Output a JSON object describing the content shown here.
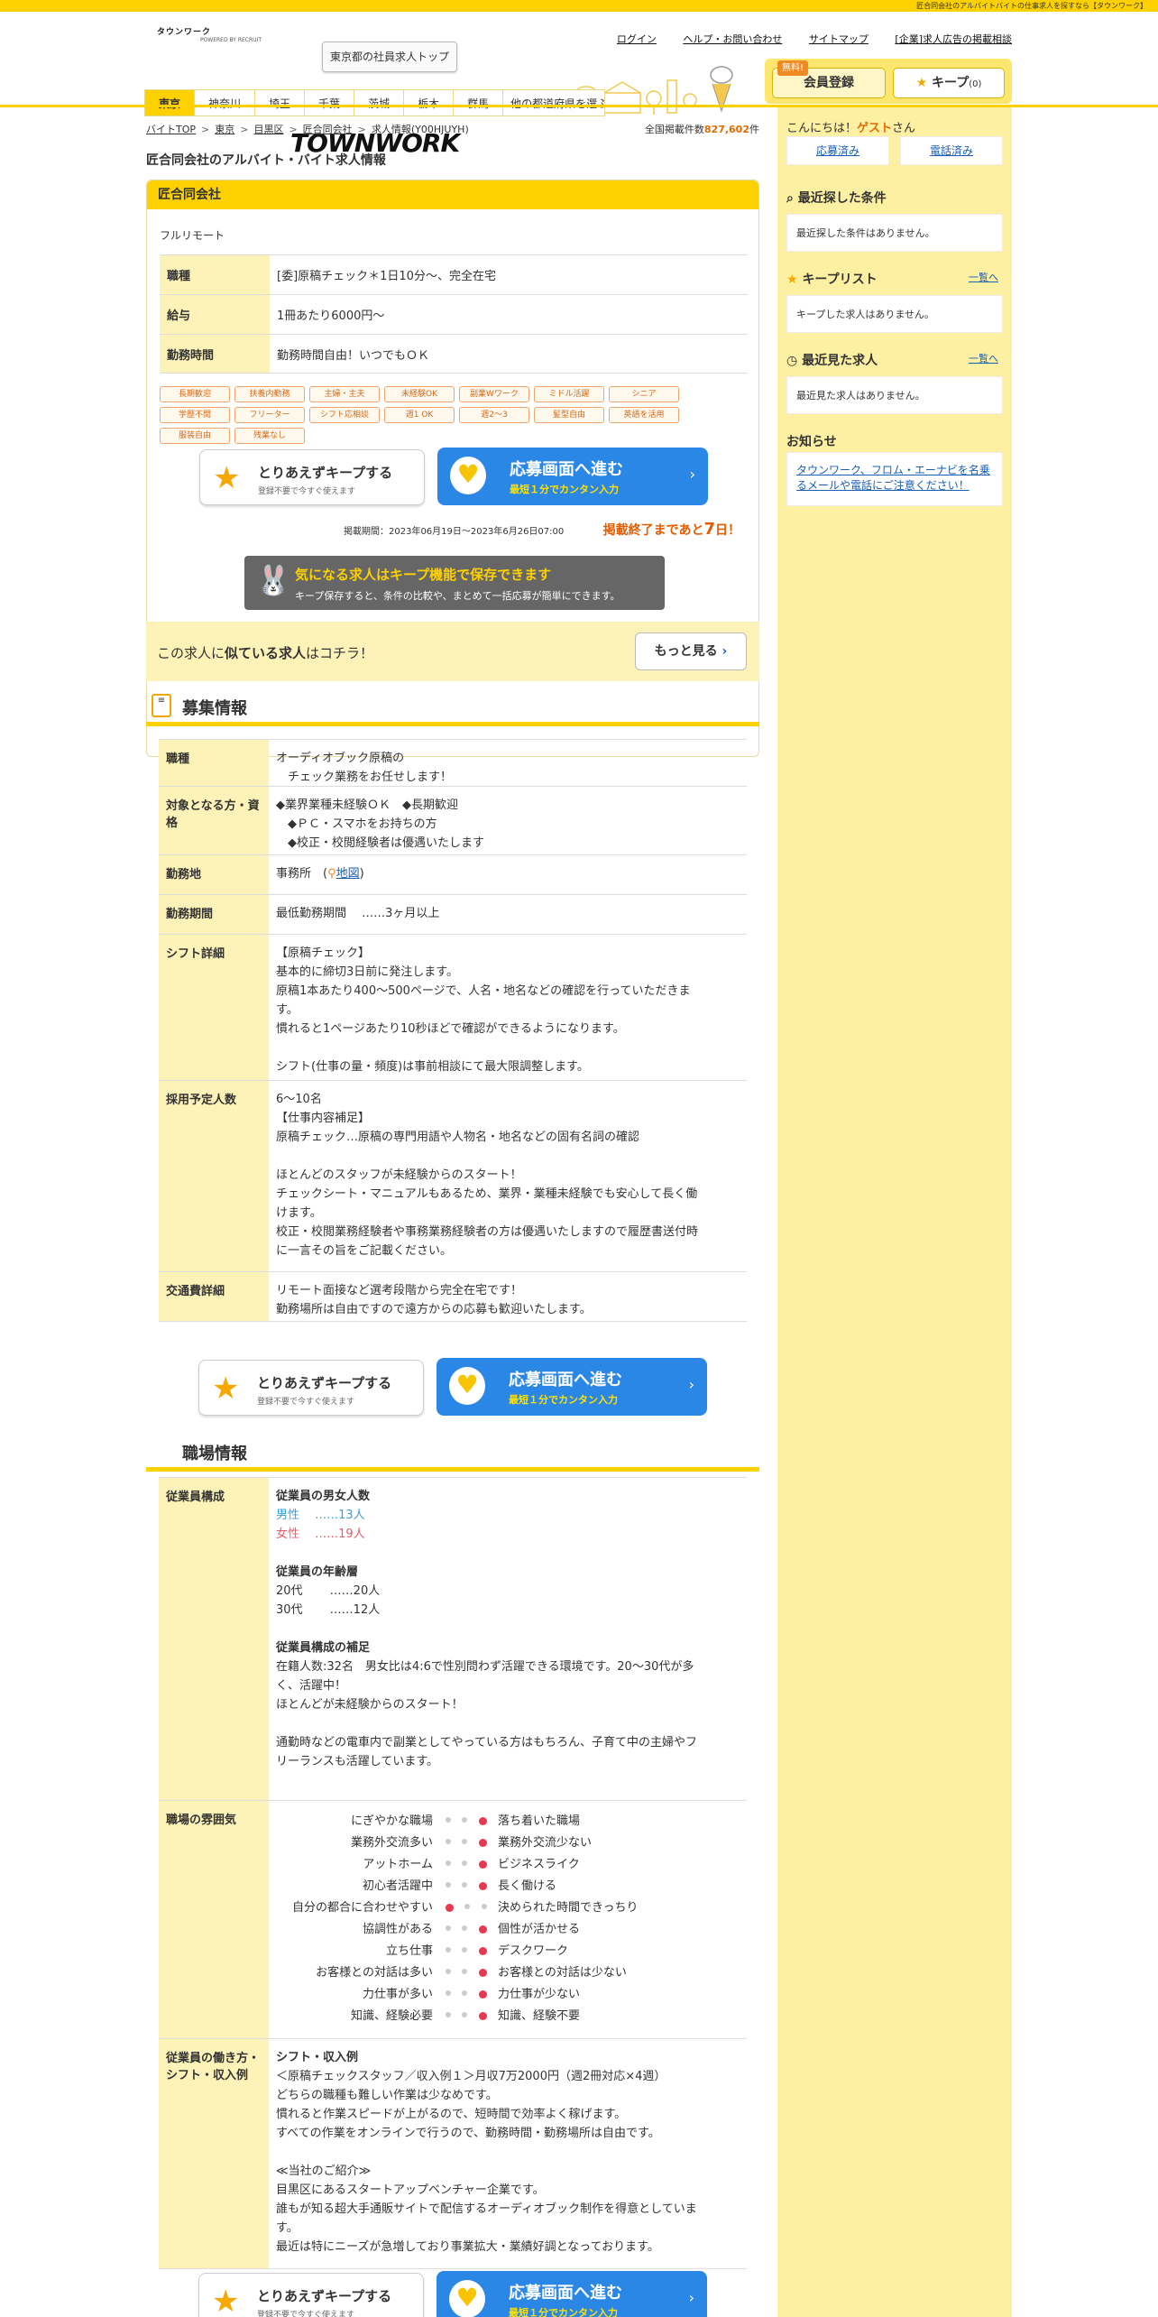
{
  "topbar": "匠合同会社のアルバイトバイトの仕事求人を探すなら【タウンワーク】",
  "logo": {
    "kana": "タウンワーク",
    "main": "TOWNWORK",
    "powered": "POWERED BY RECRUIT"
  },
  "header_button": "東京都の社員求人トップ",
  "toplinks": [
    "ログイン",
    "ヘルプ・お問い合わせ",
    "サイトマップ",
    "[企業]求人広告の掲載相談"
  ],
  "member": {
    "free": "無料!",
    "register": "会員登録",
    "keep": "キープ",
    "keep_count": "(0)"
  },
  "tabs": [
    "東京",
    "神奈川",
    "埼玉",
    "千葉",
    "茨城",
    "栃木",
    "群馬",
    "他の都道府県を選ぶ"
  ],
  "breadcrumb": [
    "バイトTOP",
    "東京",
    "目黒区",
    "匠合同会社",
    "求人情報(Y00HJUYH)"
  ],
  "count": {
    "label": "全国掲載件数",
    "value": "827,602",
    "unit": "件"
  },
  "page_title": "匠合同会社のアルバイト・バイト求人情報",
  "company": "匠合同会社",
  "remote": "フルリモート",
  "summary": [
    {
      "th": "職種",
      "td": "[委]原稿チェック＊1日10分～、完全在宅"
    },
    {
      "th": "給与",
      "td": "1冊あたり6000円～"
    },
    {
      "th": "勤務時間",
      "td": "勤務時間自由！いつでもＯＫ"
    }
  ],
  "tags": [
    "長期歓迎",
    "扶養内勤務",
    "主婦・主夫",
    "未経験OK",
    "副業Wワーク",
    "ミドル活躍",
    "シニア",
    "学歴不問",
    "フリーター",
    "シフト応相談",
    "週1 OK",
    "週2～3",
    "髪型自由",
    "英語を活用",
    "服装自由",
    "残業なし"
  ],
  "keep_cta": {
    "t1": "とりあえずキープする",
    "t2": "登録不要で今すぐ使えます"
  },
  "apply_cta": {
    "t1": "応募画面へ進む",
    "t2": "最短１分でカンタン入力"
  },
  "period": "掲載期間：2023年06月19日～2023年6月26日07:00",
  "deadline": {
    "pre": "掲載終了まであと",
    "num": "7",
    "post": "日！"
  },
  "keep_banner": {
    "t1": "気になる求人はキープ機能で保存できます",
    "t2": "キープ保存すると、条件の比較や、まとめて一括応募が簡単にできます。"
  },
  "similar": {
    "pre": "この求人に",
    "bold": "似ている求人",
    "post": "はコチラ！",
    "more": "もっと見る"
  },
  "recruit_title": "募集情報",
  "recruit": {
    "job_th": "職種",
    "job": [
      "オーディオブック原稿の",
      "　チェック業務をお任せします！"
    ],
    "target_th": "対象となる方・資格",
    "target": [
      "◆業界業種未経験ＯＫ　◆長期歓迎",
      "　◆ＰＣ・スマホをお持ちの方",
      "　◆校正・校閲経験者は優遇いたします"
    ],
    "place_th": "勤務地",
    "place_pre": "事務所　(",
    "place_link": "地図",
    "place_post": ")",
    "term_th": "勤務期間",
    "term": "最低勤務期間　 ……3ヶ月以上",
    "shift_th": "シフト詳細",
    "shift": [
      "【原稿チェック】",
      "基本的に締切3日前に発注します。",
      "原稿1本あたり400～500ページで、人名・地名などの確認を行っていただきま",
      "す。",
      "慣れると1ページあたり10秒ほどで確認ができるようになります。",
      "",
      "シフト(仕事の量・頻度)は事前相談にて最大限調整します。"
    ],
    "num_th": "採用予定人数",
    "num": [
      "6～10名",
      "【仕事内容補足】",
      "原稿チェック…原稿の専門用語や人物名・地名などの固有名詞の確認",
      "",
      "ほとんどのスタッフが未経験からのスタート！",
      "チェックシート・マニュアルもあるため、業界・業種未経験でも安心して長く働",
      "けます。",
      "校正・校閲業務経験者や事務業務経験者の方は優遇いたしますので履歴書送付時",
      "に一言その旨をご記載ください。"
    ],
    "transport_th": "交通費詳細",
    "transport": [
      "リモート面接など選考段階から完全在宅です！",
      "勤務場所は自由ですので遠方からの応募も歓迎いたします。"
    ]
  },
  "workplace_title": "職場情報",
  "workplace": {
    "staff_th": "従業員構成",
    "gender_head": "従業員の男女人数",
    "male": "男性　 ……13人",
    "female": "女性　 ……19人",
    "age_head": "従業員の年齢層",
    "age1": "20代　　 ……20人",
    "age2": "30代　　 ……12人",
    "supp_head": "従業員構成の補足",
    "supp": [
      "在籍人数:32名　男女比は4:6で性別問わず活躍できる環境です。20～30代が多",
      "く、活躍中！",
      "ほとんどが未経験からのスタート！",
      "",
      "通勤時などの電車内で副業としてやっている方はもちろん、子育て中の主婦やフ",
      "リーランスも活躍しています。"
    ],
    "atm_th": "職場の雰囲気",
    "atmosphere": [
      {
        "l": "にぎやかな職場",
        "r": "落ち着いた職場",
        "level": 3
      },
      {
        "l": "業務外交流多い",
        "r": "業務外交流少ない",
        "level": 3
      },
      {
        "l": "アットホーム",
        "r": "ビジネスライク",
        "level": 3
      },
      {
        "l": "初心者活躍中",
        "r": "長く働ける",
        "level": 3
      },
      {
        "l": "自分の都合に合わせやすい",
        "r": "決められた時間できっちり",
        "level": 1
      },
      {
        "l": "協調性がある",
        "r": "個性が活かせる",
        "level": 3
      },
      {
        "l": "立ち仕事",
        "r": "デスクワーク",
        "level": 3
      },
      {
        "l": "お客様との対話は多い",
        "r": "お客様との対話は少ない",
        "level": 3
      },
      {
        "l": "力仕事が多い",
        "r": "力仕事が少ない",
        "level": 3
      },
      {
        "l": "知識、経験必要",
        "r": "知識、経験不要",
        "level": 3
      }
    ],
    "style_th": "従業員の働き方・シフト・収入例",
    "style_head": "シフト・収入例",
    "style": [
      "＜原稿チェックスタッフ／収入例１＞月収7万2000円（週2冊対応×4週）",
      "どちらの職種も難しい作業は少なめです。",
      "慣れると作業スピードが上がるので、短時間で効率よく稼げます。",
      "すべての作業をオンラインで行うので、勤務時間・勤務場所は自由です。",
      "",
      "≪当社のご紹介≫",
      "目黒区にあるスタートアップベンチャー企業です。",
      "誰もが知る超大手通販サイトで配信するオーディオブック制作を得意としていま",
      "す。",
      "最近は特にニーズが急増しており事業拡大・業績好調となっております。"
    ]
  },
  "sidebar": {
    "greet_pre": "こんにちは！",
    "guest": "ゲスト",
    "greet_post": "さん",
    "applied": "応募済み",
    "called": "電話済み",
    "recent_cond": "最近探した条件",
    "recent_cond_empty": "最近探した条件はありません。",
    "keep_list": "キープリスト",
    "keep_link": "一覧へ",
    "keep_empty": "キープした求人はありません。",
    "recent_view": "最近見た求人",
    "view_link": "一覧へ",
    "view_empty": "最近見た求人はありません。",
    "news": "お知らせ",
    "news_link": "タウンワーク、フロム・エーナビを名乗るメールや電話にご注意ください！"
  },
  "colors": {
    "brand_yellow": "#fdd000",
    "apply_blue": "#2b87e6",
    "accent_orange": "#e45c00"
  }
}
